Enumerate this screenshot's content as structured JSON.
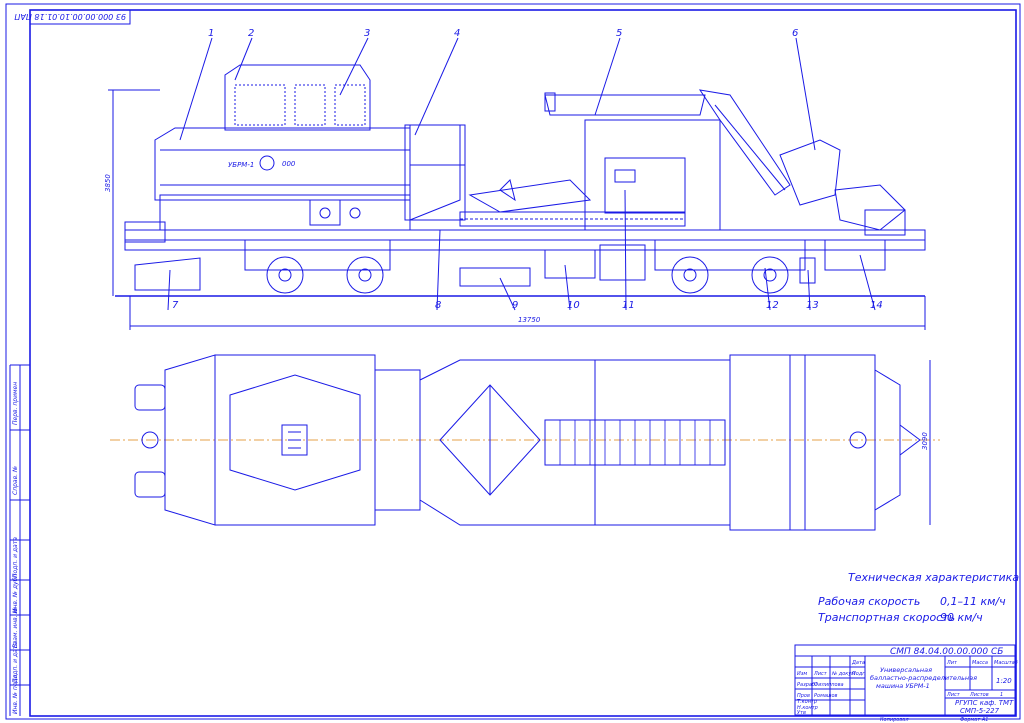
{
  "drawing": {
    "top_code": "93 000.00.00.10.01.18 ПАП",
    "callouts": [
      "1",
      "2",
      "3",
      "4",
      "5",
      "6",
      "7",
      "8",
      "9",
      "10",
      "11",
      "12",
      "13",
      "14"
    ],
    "cab_text": "УБРМ-1",
    "cab_text2": "000",
    "dim_height": "3850",
    "dim_length": "13750",
    "dim_width": "3090"
  },
  "specs": {
    "title": "Техническая характеристика",
    "rows": [
      {
        "label": "Рабочая скорость",
        "value": "0,1–11 км/ч"
      },
      {
        "label": "Транспортная скорость",
        "value": "90 км/ч"
      }
    ]
  },
  "title_block": {
    "designation": "СМП 84.04.00.00.000 СБ",
    "name_line1": "Универсальная",
    "name_line2": "балластно-распределительная",
    "name_line3": "машина УБРМ-1",
    "col_lit": "Лит",
    "col_mass": "Масса",
    "col_scale": "Масштаб",
    "scale": "1:20",
    "sheet_label": "Лист",
    "sheets_label": "Листов",
    "sheets_count": "1",
    "org1": "РГУПС каф. ТМТ",
    "org2": "СМП-5-227",
    "role_1": "Изм",
    "role_2": "Лист",
    "role_3": "№ докум",
    "role_4": "Подп",
    "role_5": "Дата",
    "role_dev": "Разраб",
    "role_chk": "Пров",
    "role_tk": "Т.контр",
    "role_nk": "Н.контр",
    "role_ut": "Утв",
    "name_dev": "Филиппова",
    "name_chk": "Ромашов",
    "copied": "Копировал",
    "format": "Формат А1"
  },
  "side_stamp": {
    "s1": "Перв. примен",
    "s2": "Справ. №",
    "s3": "Подп. и дата",
    "s4": "Инв. № дубл",
    "s5": "Взам. инв. №",
    "s6": "Подп. и дата",
    "s7": "Инв. № подл"
  }
}
